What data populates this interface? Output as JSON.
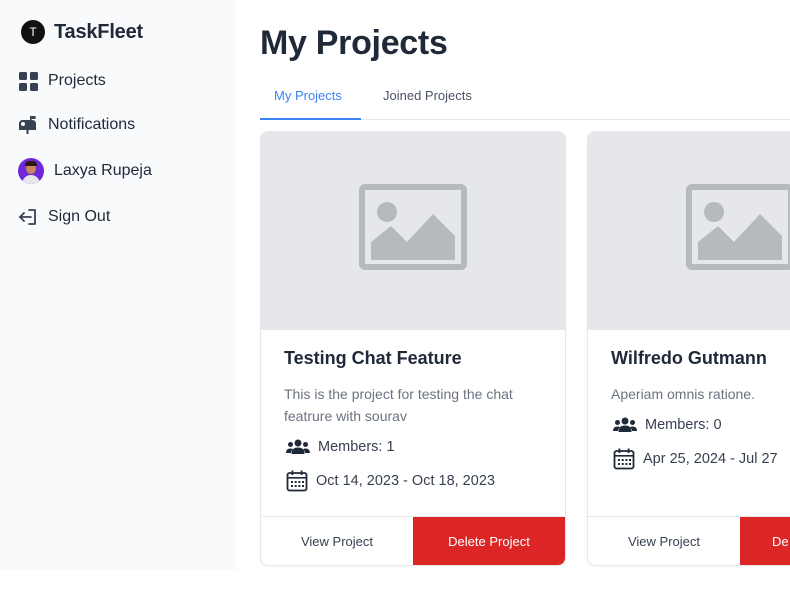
{
  "brand": {
    "initial": "T",
    "name": "TaskFleet"
  },
  "sidebar": {
    "items": [
      {
        "label": "Projects",
        "icon": "grid-icon"
      },
      {
        "label": "Notifications",
        "icon": "mailbox-icon"
      },
      {
        "label": "Laxya Rupeja",
        "icon": "avatar"
      },
      {
        "label": "Sign Out",
        "icon": "sign-out-icon"
      }
    ]
  },
  "main": {
    "title": "My Projects",
    "tabs": [
      {
        "label": "My Projects",
        "active": true
      },
      {
        "label": "Joined Projects",
        "active": false
      }
    ]
  },
  "projects": [
    {
      "title": "Testing Chat Feature",
      "description": "This is the project for testing the chat featrure with sourav",
      "members": "Members: 1",
      "dates": "Oct 14, 2023 - Oct 18, 2023",
      "view_label": "View Project",
      "delete_label": "Delete Project"
    },
    {
      "title": "Wilfredo Gutmann",
      "description": "Aperiam omnis ratione.",
      "members": "Members: 0",
      "dates": "Apr 25, 2024 - Jul 27",
      "view_label": "View Project",
      "delete_label": "De"
    }
  ],
  "colors": {
    "accent": "#3b82f6",
    "danger": "#dc2626",
    "sidebar_bg": "#f8fafc",
    "placeholder_bg": "#e5e7eb"
  }
}
